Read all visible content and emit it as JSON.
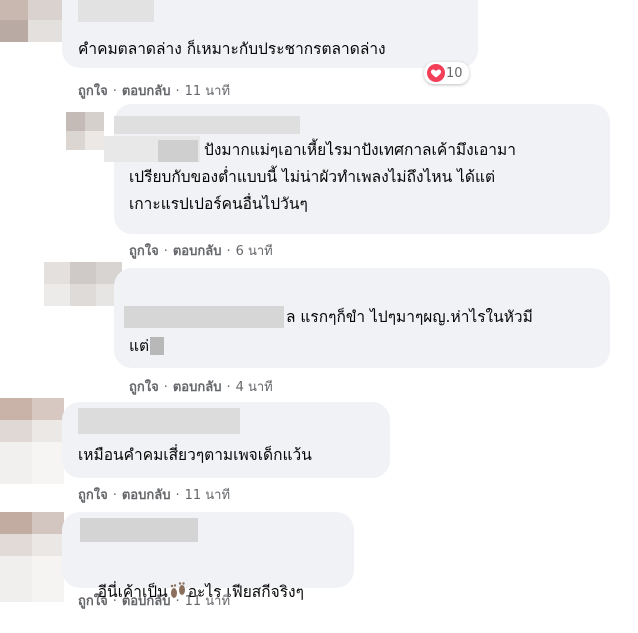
{
  "actions": {
    "like": "ถูกใจ",
    "reply": "ตอบกลับ",
    "separator": "·"
  },
  "comments": [
    {
      "text": "คำคมตลาดล่าง ก็เหมาะกับประชากรตลาดล่าง",
      "time": "11 นาที",
      "reaction_count": "10",
      "reaction_icons": [
        "like-icon",
        "love-icon"
      ]
    },
    {
      "text_line1": "ปังมากแม่ๆเอาเหี้ยไรมาปังเทศกาลเค้ามึงเอามา",
      "text_line2": "เปรียบกับของต่ำแบบนี้ ไม่น่าผัวทำเพลงไม่ถึงไหน ได้แต่",
      "text_line3": "เกาะแรปเปอร์คนอื่นไปวันๆ",
      "time": "6 นาที"
    },
    {
      "text_line1": "ล แรกๆก็ขำ ไปๆมาๆผญ.ห่าไรในหัวมี",
      "text_line2": "แต่",
      "time": "4 นาที"
    },
    {
      "text": "เหมือนคำคมเสี่ยวๆตามเพจเด็กแว้น",
      "time": "11 นาที"
    },
    {
      "text_before": "อีนี่เค้าเป็น",
      "emoji": "footprints-icon",
      "text_after": "อะไร เฟียสกีจริงๆ",
      "time": "11 นาที"
    }
  ],
  "colors": {
    "bubble": "#f0f2f5",
    "meta": "#65676b",
    "text": "#050505",
    "love": "#f33e58",
    "like": "#1877f2"
  }
}
